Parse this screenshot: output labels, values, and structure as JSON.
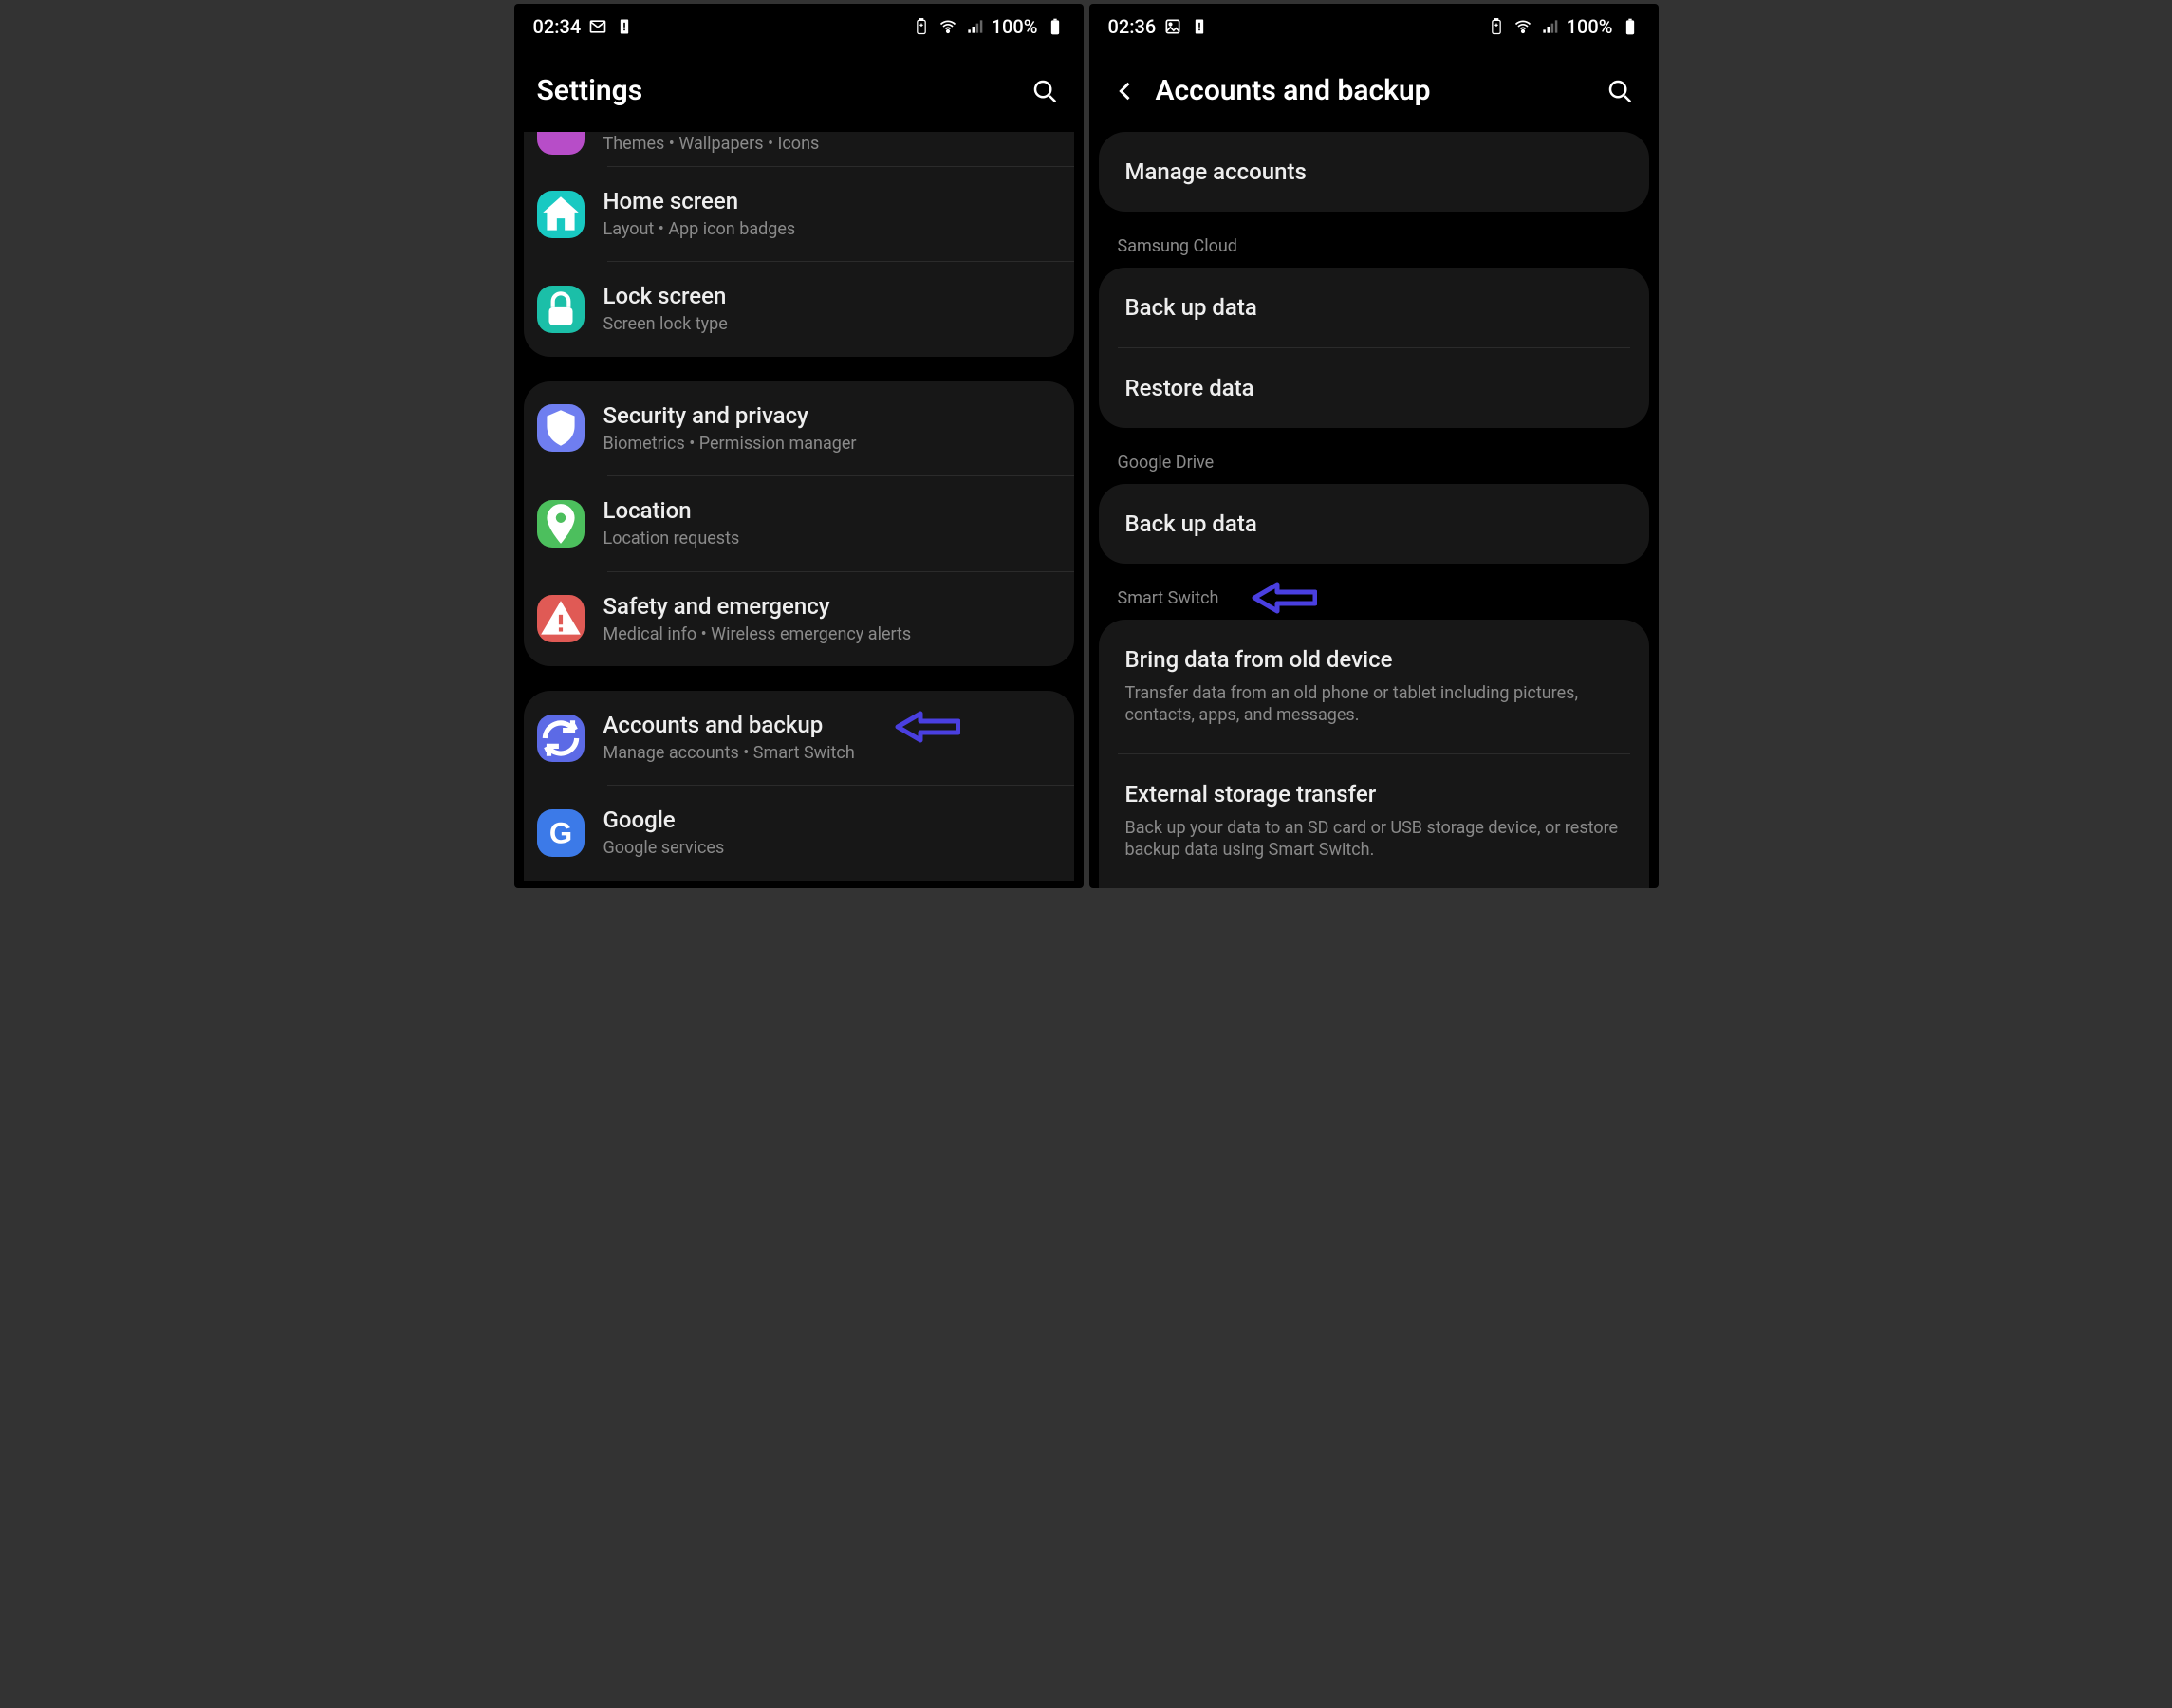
{
  "left": {
    "status": {
      "time": "02:34",
      "battery_text": "100%"
    },
    "header_title": "Settings",
    "partial_top_sub": "Themes  •  Wallpapers  •  Icons",
    "groups": [
      {
        "rows": [
          {
            "key": "home",
            "title": "Home screen",
            "sub": "Layout  •  App icon badges",
            "color": "#18c9c2",
            "icon": "home"
          },
          {
            "key": "lock",
            "title": "Lock screen",
            "sub": "Screen lock type",
            "color": "#1bbfa8",
            "icon": "lock"
          }
        ]
      },
      {
        "rows": [
          {
            "key": "security",
            "title": "Security and privacy",
            "sub": "Biometrics  •  Permission manager",
            "color": "#6f7ef0",
            "icon": "shield"
          },
          {
            "key": "location",
            "title": "Location",
            "sub": "Location requests",
            "color": "#4cbf5d",
            "icon": "pin"
          },
          {
            "key": "safety",
            "title": "Safety and emergency",
            "sub": "Medical info  •  Wireless emergency alerts",
            "color": "#e05a55",
            "icon": "alert"
          }
        ]
      },
      {
        "rows": [
          {
            "key": "accounts",
            "title": "Accounts and backup",
            "sub": "Manage accounts  •  Smart Switch",
            "color": "#5c6ae6",
            "icon": "sync",
            "arrow": true
          },
          {
            "key": "google",
            "title": "Google",
            "sub": "Google services",
            "color": "#3c7ae8",
            "icon": "google"
          }
        ]
      }
    ]
  },
  "right": {
    "status": {
      "time": "02:36",
      "battery_text": "100%"
    },
    "header_title": "Accounts and backup",
    "sections": [
      {
        "label": null,
        "rows": [
          {
            "key": "manage",
            "title": "Manage accounts"
          }
        ]
      },
      {
        "label": "Samsung Cloud",
        "rows": [
          {
            "key": "sc_backup",
            "title": "Back up data"
          },
          {
            "key": "sc_restore",
            "title": "Restore data"
          }
        ]
      },
      {
        "label": "Google Drive",
        "rows": [
          {
            "key": "gd_backup",
            "title": "Back up data"
          }
        ]
      },
      {
        "label": "Smart Switch",
        "arrow": true,
        "rows": [
          {
            "key": "bring",
            "title": "Bring data from old device",
            "sub": "Transfer data from an old phone or tablet including pictures, contacts, apps, and messages."
          },
          {
            "key": "external",
            "title": "External storage transfer",
            "sub": "Back up your data to an SD card or USB storage device, or restore backup data using Smart Switch."
          }
        ]
      }
    ]
  }
}
